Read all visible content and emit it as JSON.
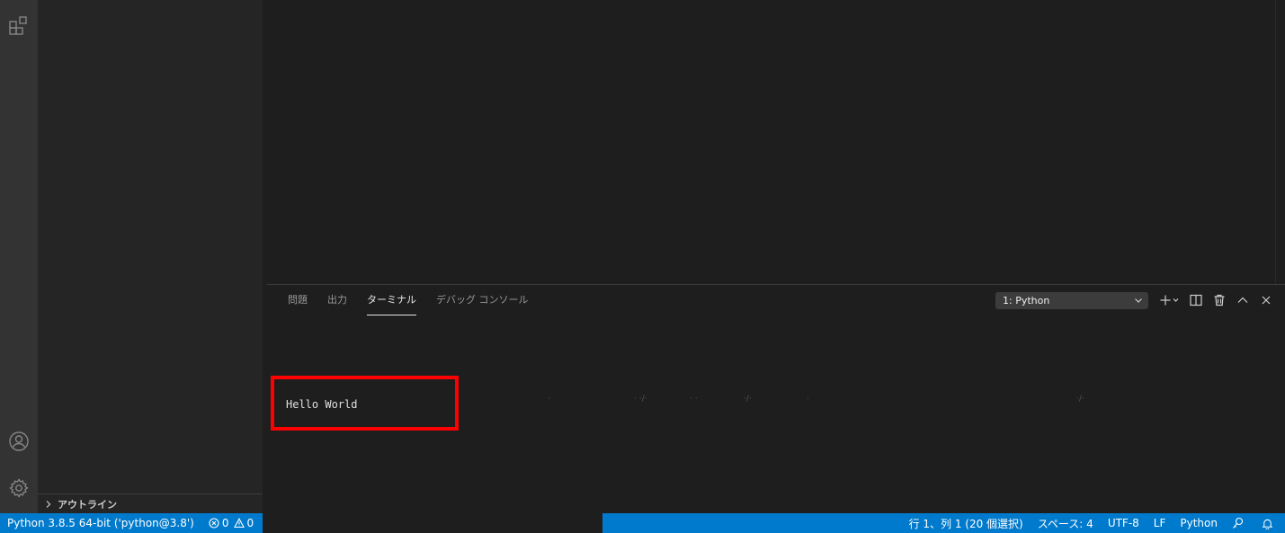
{
  "sidebar": {
    "outline_label": "アウトライン"
  },
  "panel": {
    "tabs": [
      {
        "label": "問題",
        "active": false
      },
      {
        "label": "出力",
        "active": false
      },
      {
        "label": "ターミナル",
        "active": true
      },
      {
        "label": "デバッグ コンソール",
        "active": false
      }
    ],
    "terminal_select": "1: Python"
  },
  "terminal": {
    "output": "Hello World"
  },
  "statusbar": {
    "interpreter": "Python 3.8.5 64-bit ('python@3.8')",
    "errors": "0",
    "warnings": "0",
    "position": "行 1、列 1 (20 個選択)",
    "indent": "スペース: 4",
    "encoding": "UTF-8",
    "eol": "LF",
    "language": "Python"
  },
  "colors": {
    "accent": "#007acc",
    "highlight": "#ff0000",
    "background": "#1e1e1e"
  }
}
